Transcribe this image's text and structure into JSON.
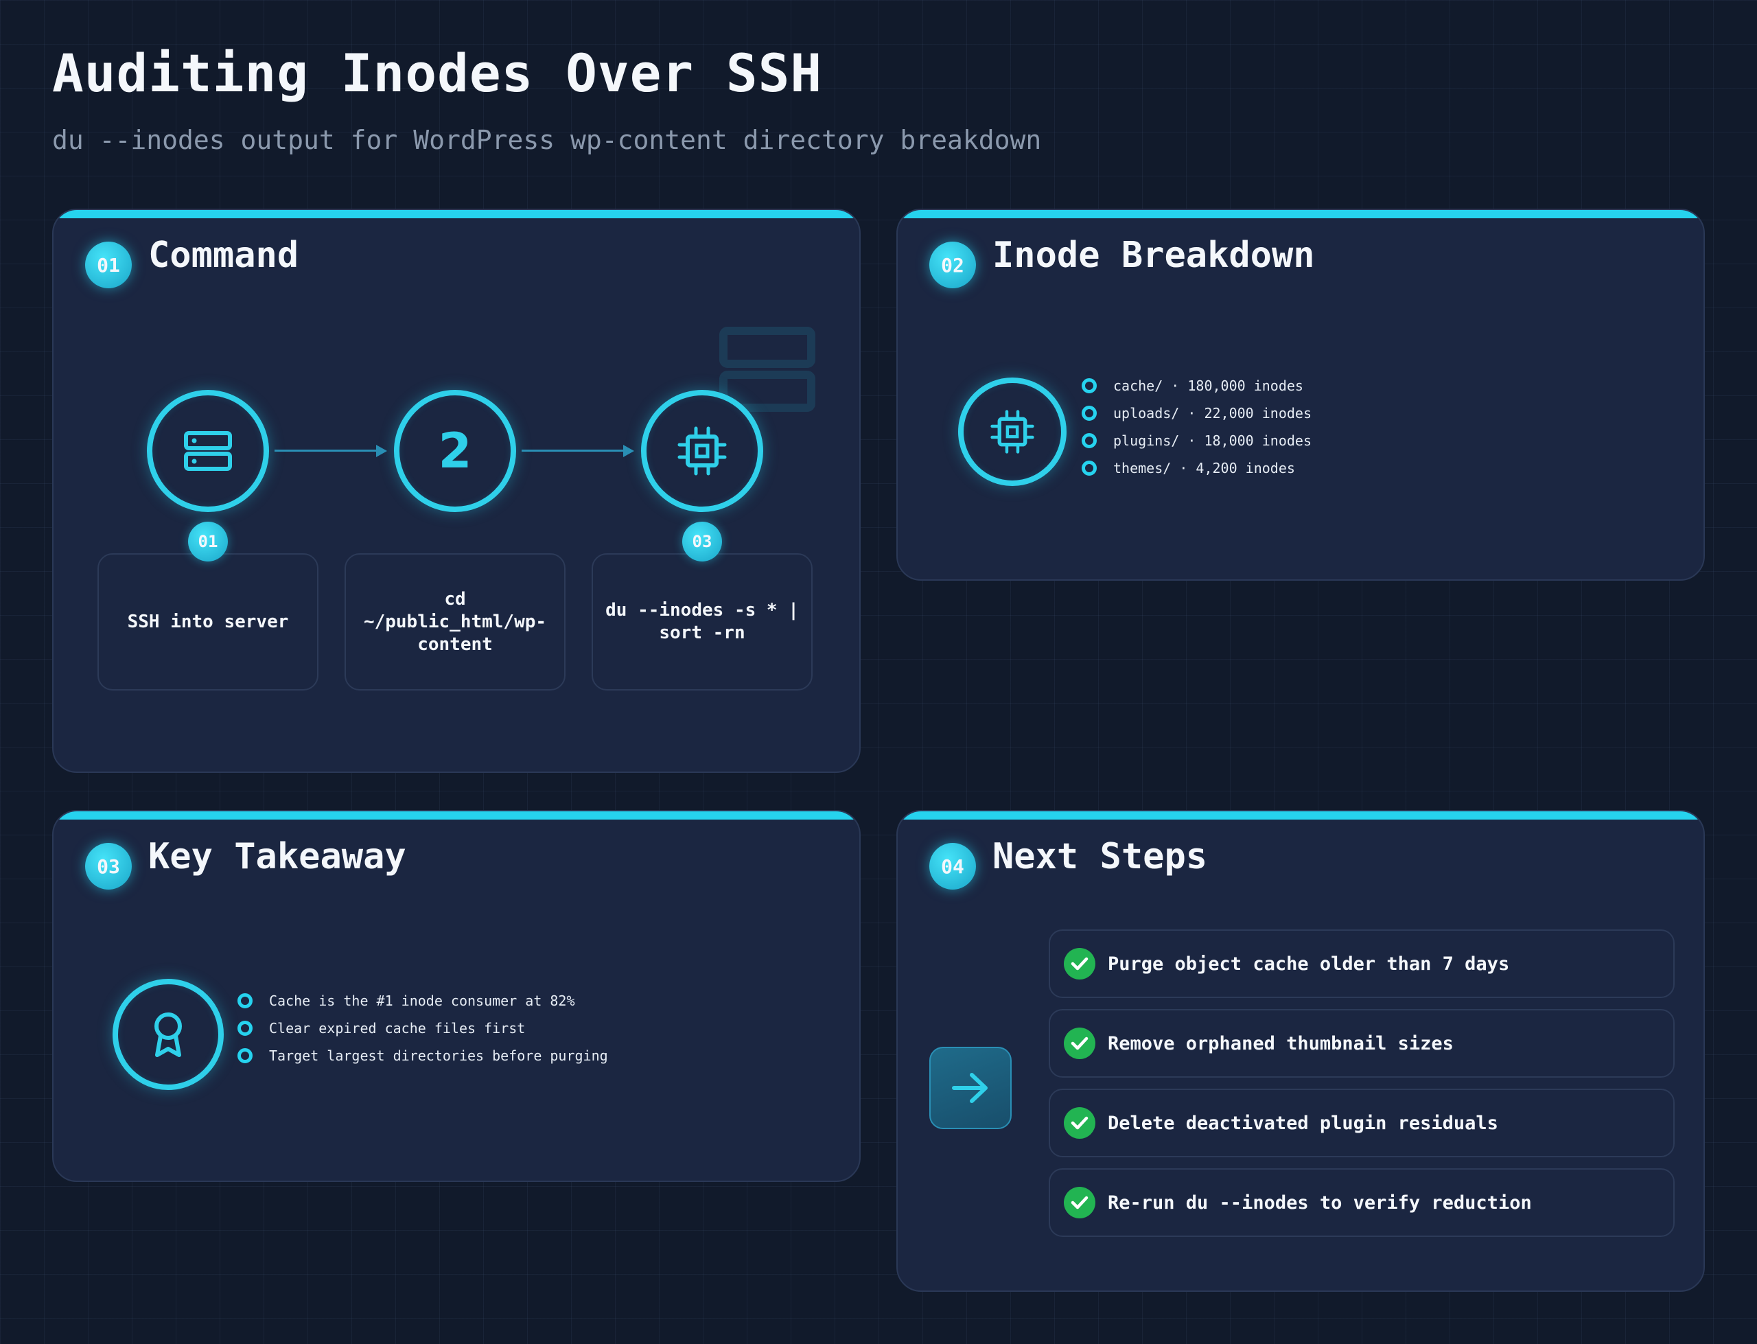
{
  "header": {
    "title": "Auditing Inodes Over SSH",
    "subtitle": "du --inodes output for WordPress wp-content directory breakdown"
  },
  "colors": {
    "accent": "#26d3ef",
    "background": "#111a2b",
    "card": "#1b2641",
    "check": "#22b452"
  },
  "cards": {
    "command": {
      "number": "01",
      "title": "Command",
      "flow": {
        "nodes": [
          {
            "icon": "server-icon",
            "badge": "01",
            "label": "SSH into server"
          },
          {
            "text": "2",
            "label": "cd ~/public_html/wp-content"
          },
          {
            "icon": "chip-icon",
            "badge": "03",
            "label": "du --inodes -s * | sort -rn"
          }
        ]
      }
    },
    "breakdown": {
      "number": "02",
      "title": "Inode Breakdown",
      "icon": "chip-icon",
      "items": [
        "cache/ · 180,000 inodes",
        "uploads/ · 22,000 inodes",
        "plugins/ · 18,000 inodes",
        "themes/ · 4,200 inodes"
      ]
    },
    "takeaway": {
      "number": "03",
      "title": "Key Takeaway",
      "icon": "award-icon",
      "items": [
        "Cache is the #1 inode consumer at 82%",
        "Clear expired cache files first",
        "Target largest directories before purging"
      ]
    },
    "next": {
      "number": "04",
      "title": "Next Steps",
      "icon": "arrow-right-icon",
      "items": [
        "Purge object cache older than 7 days",
        "Remove orphaned thumbnail sizes",
        "Delete deactivated plugin residuals",
        "Re-run du --inodes to verify reduction"
      ]
    }
  }
}
